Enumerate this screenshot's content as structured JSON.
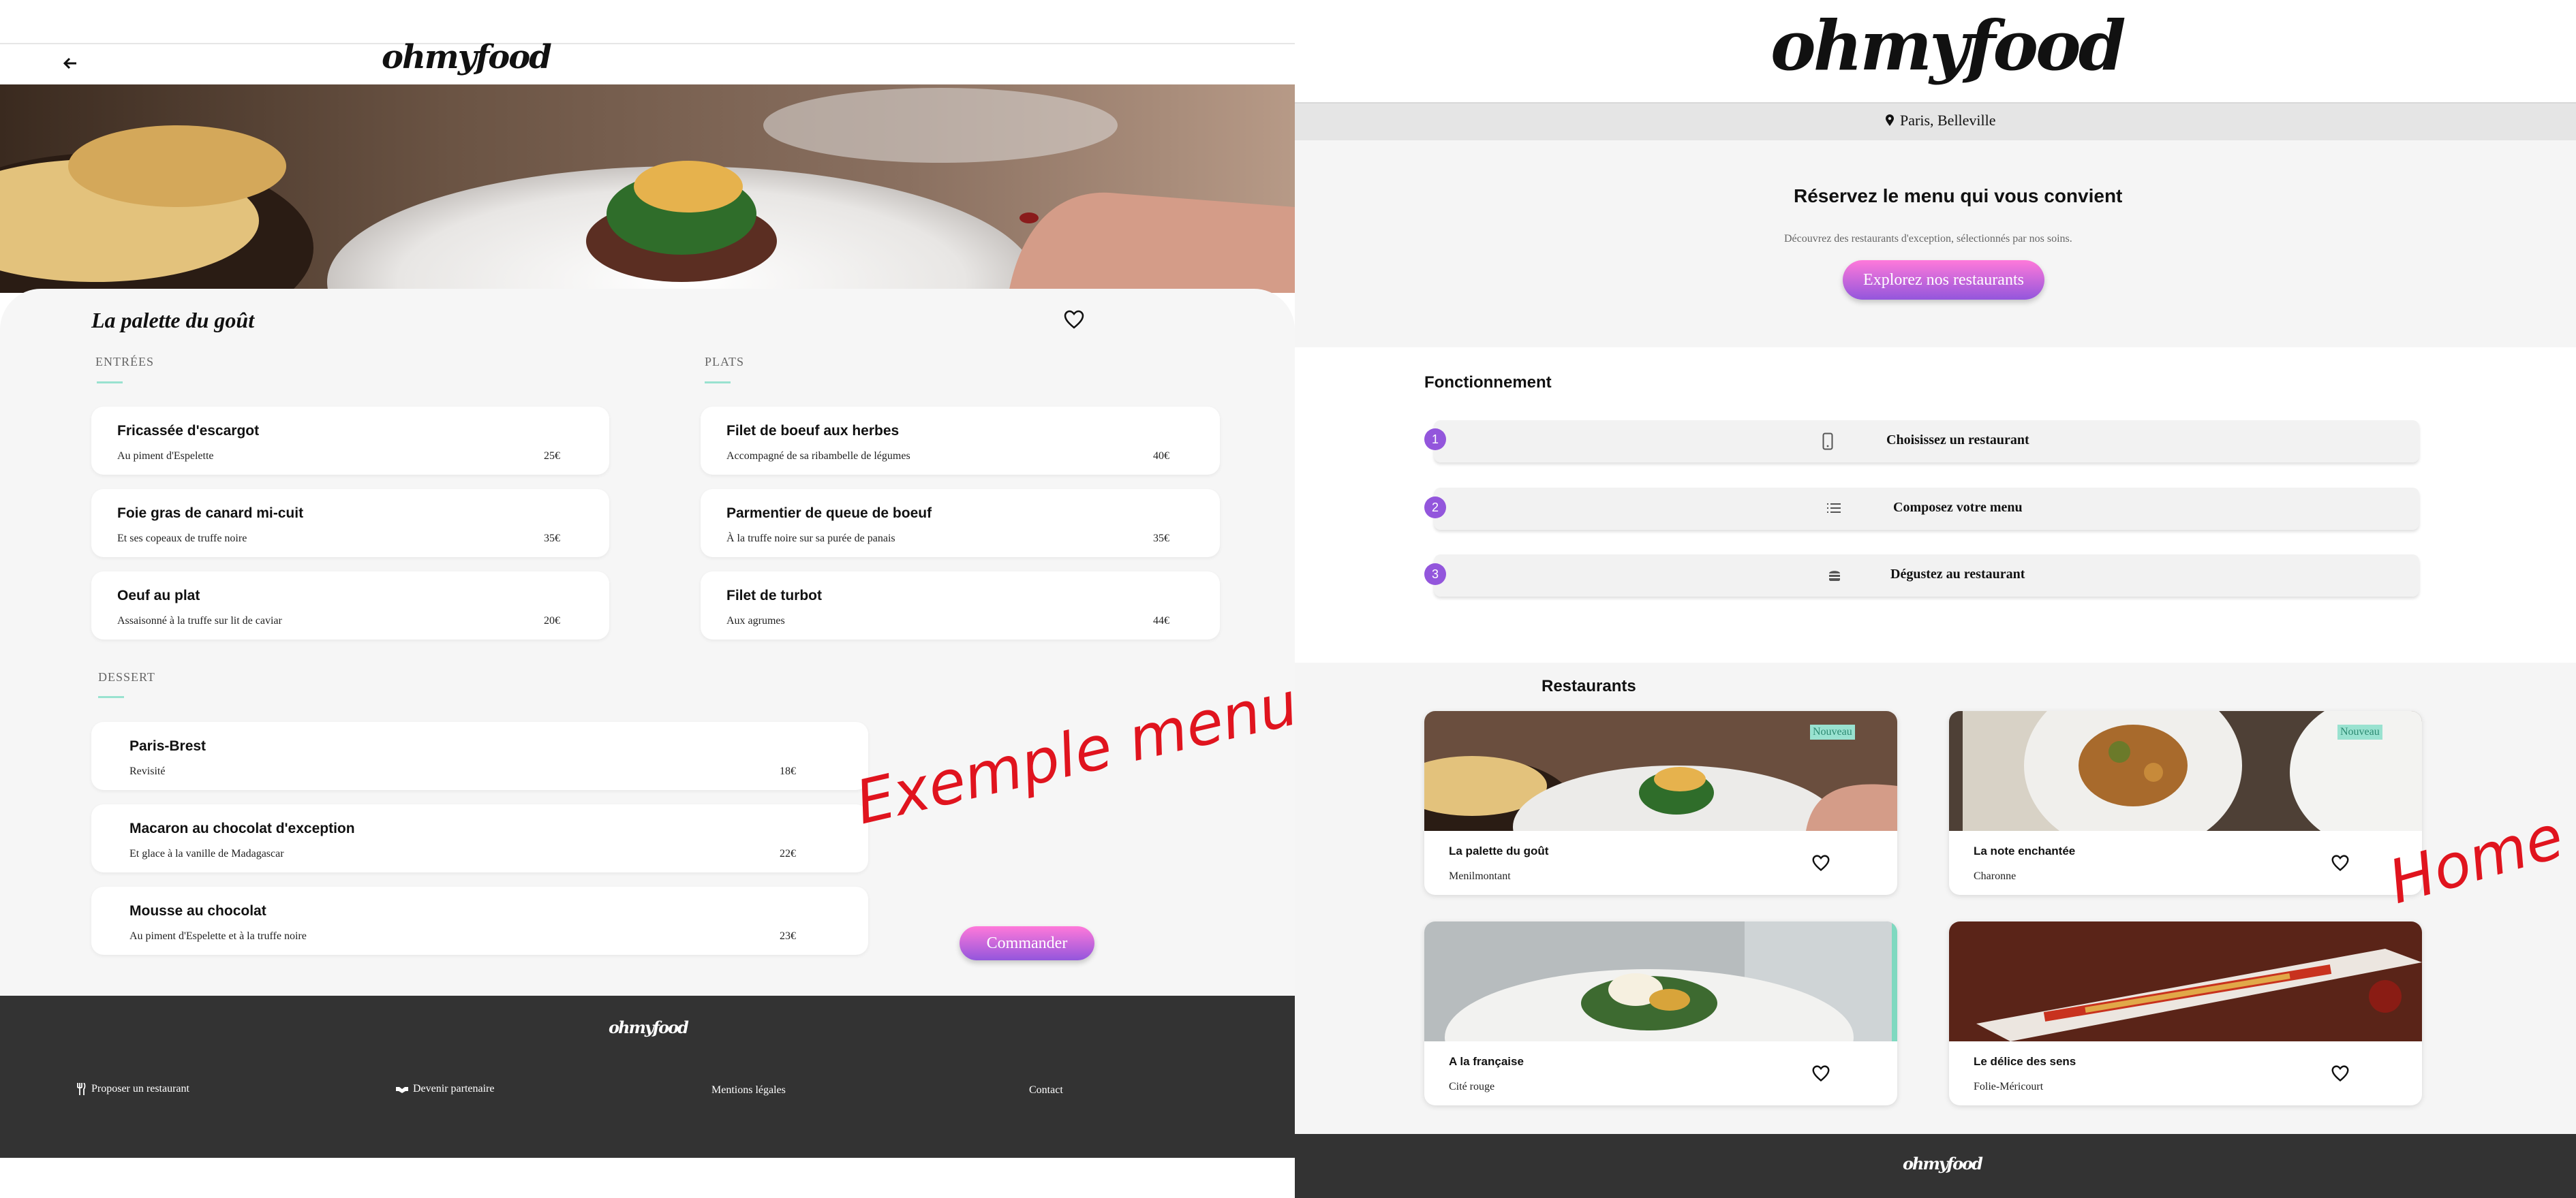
{
  "menu_page": {
    "logo": "ohmyfood",
    "restaurant_name": "La palette du goût",
    "sections": {
      "entrees": {
        "title": "ENTRÉES",
        "items": [
          {
            "name": "Fricassée d'escargot",
            "desc": "Au piment d'Espelette",
            "price": "25€"
          },
          {
            "name": "Foie gras de canard mi-cuit",
            "desc": "Et ses copeaux de truffe noire",
            "price": "35€"
          },
          {
            "name": "Oeuf au plat",
            "desc": "Assaisonné à la truffe sur lit de caviar",
            "price": "20€"
          }
        ]
      },
      "plats": {
        "title": "PLATS",
        "items": [
          {
            "name": "Filet de boeuf aux herbes",
            "desc": "Accompagné de sa ribambelle de légumes",
            "price": "40€"
          },
          {
            "name": "Parmentier de queue de boeuf",
            "desc": "À la truffe noire sur sa purée de panais",
            "price": "35€"
          },
          {
            "name": "Filet de turbot",
            "desc": "Aux agrumes",
            "price": "44€"
          }
        ]
      },
      "dessert": {
        "title": "DESSERT",
        "items": [
          {
            "name": "Paris-Brest",
            "desc": "Revisité",
            "price": "18€"
          },
          {
            "name": "Macaron au chocolat d'exception",
            "desc": "Et glace à la vanille de Madagascar",
            "price": "22€"
          },
          {
            "name": "Mousse au chocolat",
            "desc": "Au piment d'Espelette et à la truffe noire",
            "price": "23€"
          }
        ]
      }
    },
    "order_button": "Commander",
    "annotation": "Exemple menu",
    "footer": {
      "logo": "ohmyfood",
      "links": [
        "Proposer un restaurant",
        "Devenir partenaire",
        "Mentions légales",
        "Contact"
      ]
    }
  },
  "home_page": {
    "logo": "ohmyfood",
    "location": "Paris, Belleville",
    "hero_title": "Réservez le menu qui vous convient",
    "hero_subtitle": "Découvrez des restaurants d'exception, sélectionnés par nos soins.",
    "explore_button": "Explorez nos restaurants",
    "how_title": "Fonctionnement",
    "steps": [
      {
        "num": "1",
        "label": "Choisissez un restaurant",
        "icon": "phone-icon"
      },
      {
        "num": "2",
        "label": "Composez votre menu",
        "icon": "list-icon"
      },
      {
        "num": "3",
        "label": "Dégustez au restaurant",
        "icon": "food-icon"
      }
    ],
    "restaurants_title": "Restaurants",
    "restaurants": [
      {
        "name": "La palette du goût",
        "location": "Menilmontant",
        "badge": "Nouveau"
      },
      {
        "name": "La note enchantée",
        "location": "Charonne",
        "badge": "Nouveau"
      },
      {
        "name": "A la française",
        "location": "Cité rouge",
        "badge": ""
      },
      {
        "name": "Le délice des sens",
        "location": "Folie-Méricourt",
        "badge": ""
      }
    ],
    "annotation": "Home",
    "footer_logo": "ohmyfood"
  },
  "colors": {
    "accent_pink": "#ff79da",
    "accent_purple": "#9356dc",
    "mint": "#99e2d0",
    "footer": "#333333",
    "annotation": "#e0141e"
  }
}
